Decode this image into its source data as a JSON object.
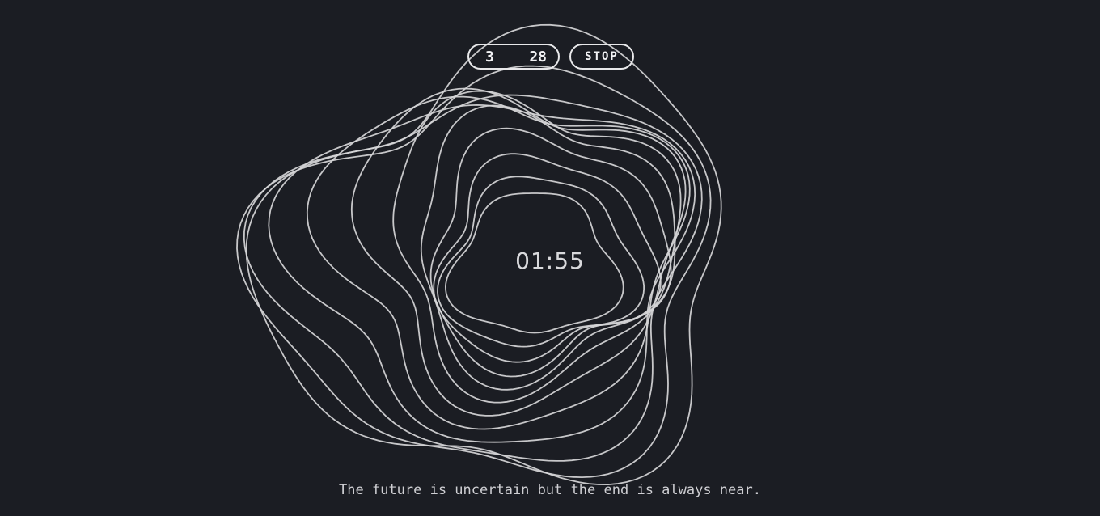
{
  "timer": {
    "minutes_value": "3",
    "seconds_value": "28",
    "stop_label": "STOP",
    "countdown": "01:55"
  },
  "tagline": "The future is uncertain but the end is always near.",
  "visual": {
    "ring_count": 12,
    "ring_color": "#d6d6d8",
    "background_color": "#1b1d23"
  }
}
